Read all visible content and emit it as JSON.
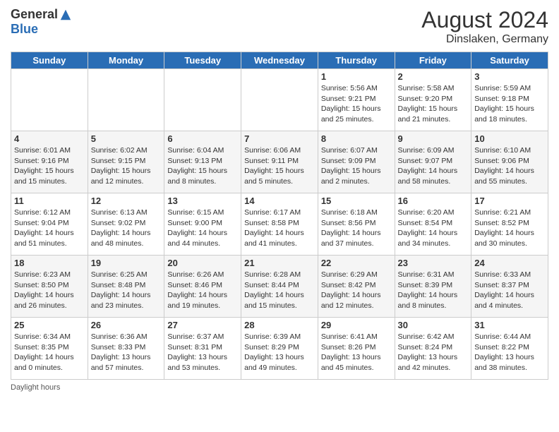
{
  "header": {
    "logo_general": "General",
    "logo_blue": "Blue",
    "month_year": "August 2024",
    "location": "Dinslaken, Germany"
  },
  "days_of_week": [
    "Sunday",
    "Monday",
    "Tuesday",
    "Wednesday",
    "Thursday",
    "Friday",
    "Saturday"
  ],
  "weeks": [
    [
      {
        "day": "",
        "info": ""
      },
      {
        "day": "",
        "info": ""
      },
      {
        "day": "",
        "info": ""
      },
      {
        "day": "",
        "info": ""
      },
      {
        "day": "1",
        "info": "Sunrise: 5:56 AM\nSunset: 9:21 PM\nDaylight: 15 hours\nand 25 minutes."
      },
      {
        "day": "2",
        "info": "Sunrise: 5:58 AM\nSunset: 9:20 PM\nDaylight: 15 hours\nand 21 minutes."
      },
      {
        "day": "3",
        "info": "Sunrise: 5:59 AM\nSunset: 9:18 PM\nDaylight: 15 hours\nand 18 minutes."
      }
    ],
    [
      {
        "day": "4",
        "info": "Sunrise: 6:01 AM\nSunset: 9:16 PM\nDaylight: 15 hours\nand 15 minutes."
      },
      {
        "day": "5",
        "info": "Sunrise: 6:02 AM\nSunset: 9:15 PM\nDaylight: 15 hours\nand 12 minutes."
      },
      {
        "day": "6",
        "info": "Sunrise: 6:04 AM\nSunset: 9:13 PM\nDaylight: 15 hours\nand 8 minutes."
      },
      {
        "day": "7",
        "info": "Sunrise: 6:06 AM\nSunset: 9:11 PM\nDaylight: 15 hours\nand 5 minutes."
      },
      {
        "day": "8",
        "info": "Sunrise: 6:07 AM\nSunset: 9:09 PM\nDaylight: 15 hours\nand 2 minutes."
      },
      {
        "day": "9",
        "info": "Sunrise: 6:09 AM\nSunset: 9:07 PM\nDaylight: 14 hours\nand 58 minutes."
      },
      {
        "day": "10",
        "info": "Sunrise: 6:10 AM\nSunset: 9:06 PM\nDaylight: 14 hours\nand 55 minutes."
      }
    ],
    [
      {
        "day": "11",
        "info": "Sunrise: 6:12 AM\nSunset: 9:04 PM\nDaylight: 14 hours\nand 51 minutes."
      },
      {
        "day": "12",
        "info": "Sunrise: 6:13 AM\nSunset: 9:02 PM\nDaylight: 14 hours\nand 48 minutes."
      },
      {
        "day": "13",
        "info": "Sunrise: 6:15 AM\nSunset: 9:00 PM\nDaylight: 14 hours\nand 44 minutes."
      },
      {
        "day": "14",
        "info": "Sunrise: 6:17 AM\nSunset: 8:58 PM\nDaylight: 14 hours\nand 41 minutes."
      },
      {
        "day": "15",
        "info": "Sunrise: 6:18 AM\nSunset: 8:56 PM\nDaylight: 14 hours\nand 37 minutes."
      },
      {
        "day": "16",
        "info": "Sunrise: 6:20 AM\nSunset: 8:54 PM\nDaylight: 14 hours\nand 34 minutes."
      },
      {
        "day": "17",
        "info": "Sunrise: 6:21 AM\nSunset: 8:52 PM\nDaylight: 14 hours\nand 30 minutes."
      }
    ],
    [
      {
        "day": "18",
        "info": "Sunrise: 6:23 AM\nSunset: 8:50 PM\nDaylight: 14 hours\nand 26 minutes."
      },
      {
        "day": "19",
        "info": "Sunrise: 6:25 AM\nSunset: 8:48 PM\nDaylight: 14 hours\nand 23 minutes."
      },
      {
        "day": "20",
        "info": "Sunrise: 6:26 AM\nSunset: 8:46 PM\nDaylight: 14 hours\nand 19 minutes."
      },
      {
        "day": "21",
        "info": "Sunrise: 6:28 AM\nSunset: 8:44 PM\nDaylight: 14 hours\nand 15 minutes."
      },
      {
        "day": "22",
        "info": "Sunrise: 6:29 AM\nSunset: 8:42 PM\nDaylight: 14 hours\nand 12 minutes."
      },
      {
        "day": "23",
        "info": "Sunrise: 6:31 AM\nSunset: 8:39 PM\nDaylight: 14 hours\nand 8 minutes."
      },
      {
        "day": "24",
        "info": "Sunrise: 6:33 AM\nSunset: 8:37 PM\nDaylight: 14 hours\nand 4 minutes."
      }
    ],
    [
      {
        "day": "25",
        "info": "Sunrise: 6:34 AM\nSunset: 8:35 PM\nDaylight: 14 hours\nand 0 minutes."
      },
      {
        "day": "26",
        "info": "Sunrise: 6:36 AM\nSunset: 8:33 PM\nDaylight: 13 hours\nand 57 minutes."
      },
      {
        "day": "27",
        "info": "Sunrise: 6:37 AM\nSunset: 8:31 PM\nDaylight: 13 hours\nand 53 minutes."
      },
      {
        "day": "28",
        "info": "Sunrise: 6:39 AM\nSunset: 8:29 PM\nDaylight: 13 hours\nand 49 minutes."
      },
      {
        "day": "29",
        "info": "Sunrise: 6:41 AM\nSunset: 8:26 PM\nDaylight: 13 hours\nand 45 minutes."
      },
      {
        "day": "30",
        "info": "Sunrise: 6:42 AM\nSunset: 8:24 PM\nDaylight: 13 hours\nand 42 minutes."
      },
      {
        "day": "31",
        "info": "Sunrise: 6:44 AM\nSunset: 8:22 PM\nDaylight: 13 hours\nand 38 minutes."
      }
    ]
  ],
  "footer": {
    "daylight_label": "Daylight hours"
  }
}
